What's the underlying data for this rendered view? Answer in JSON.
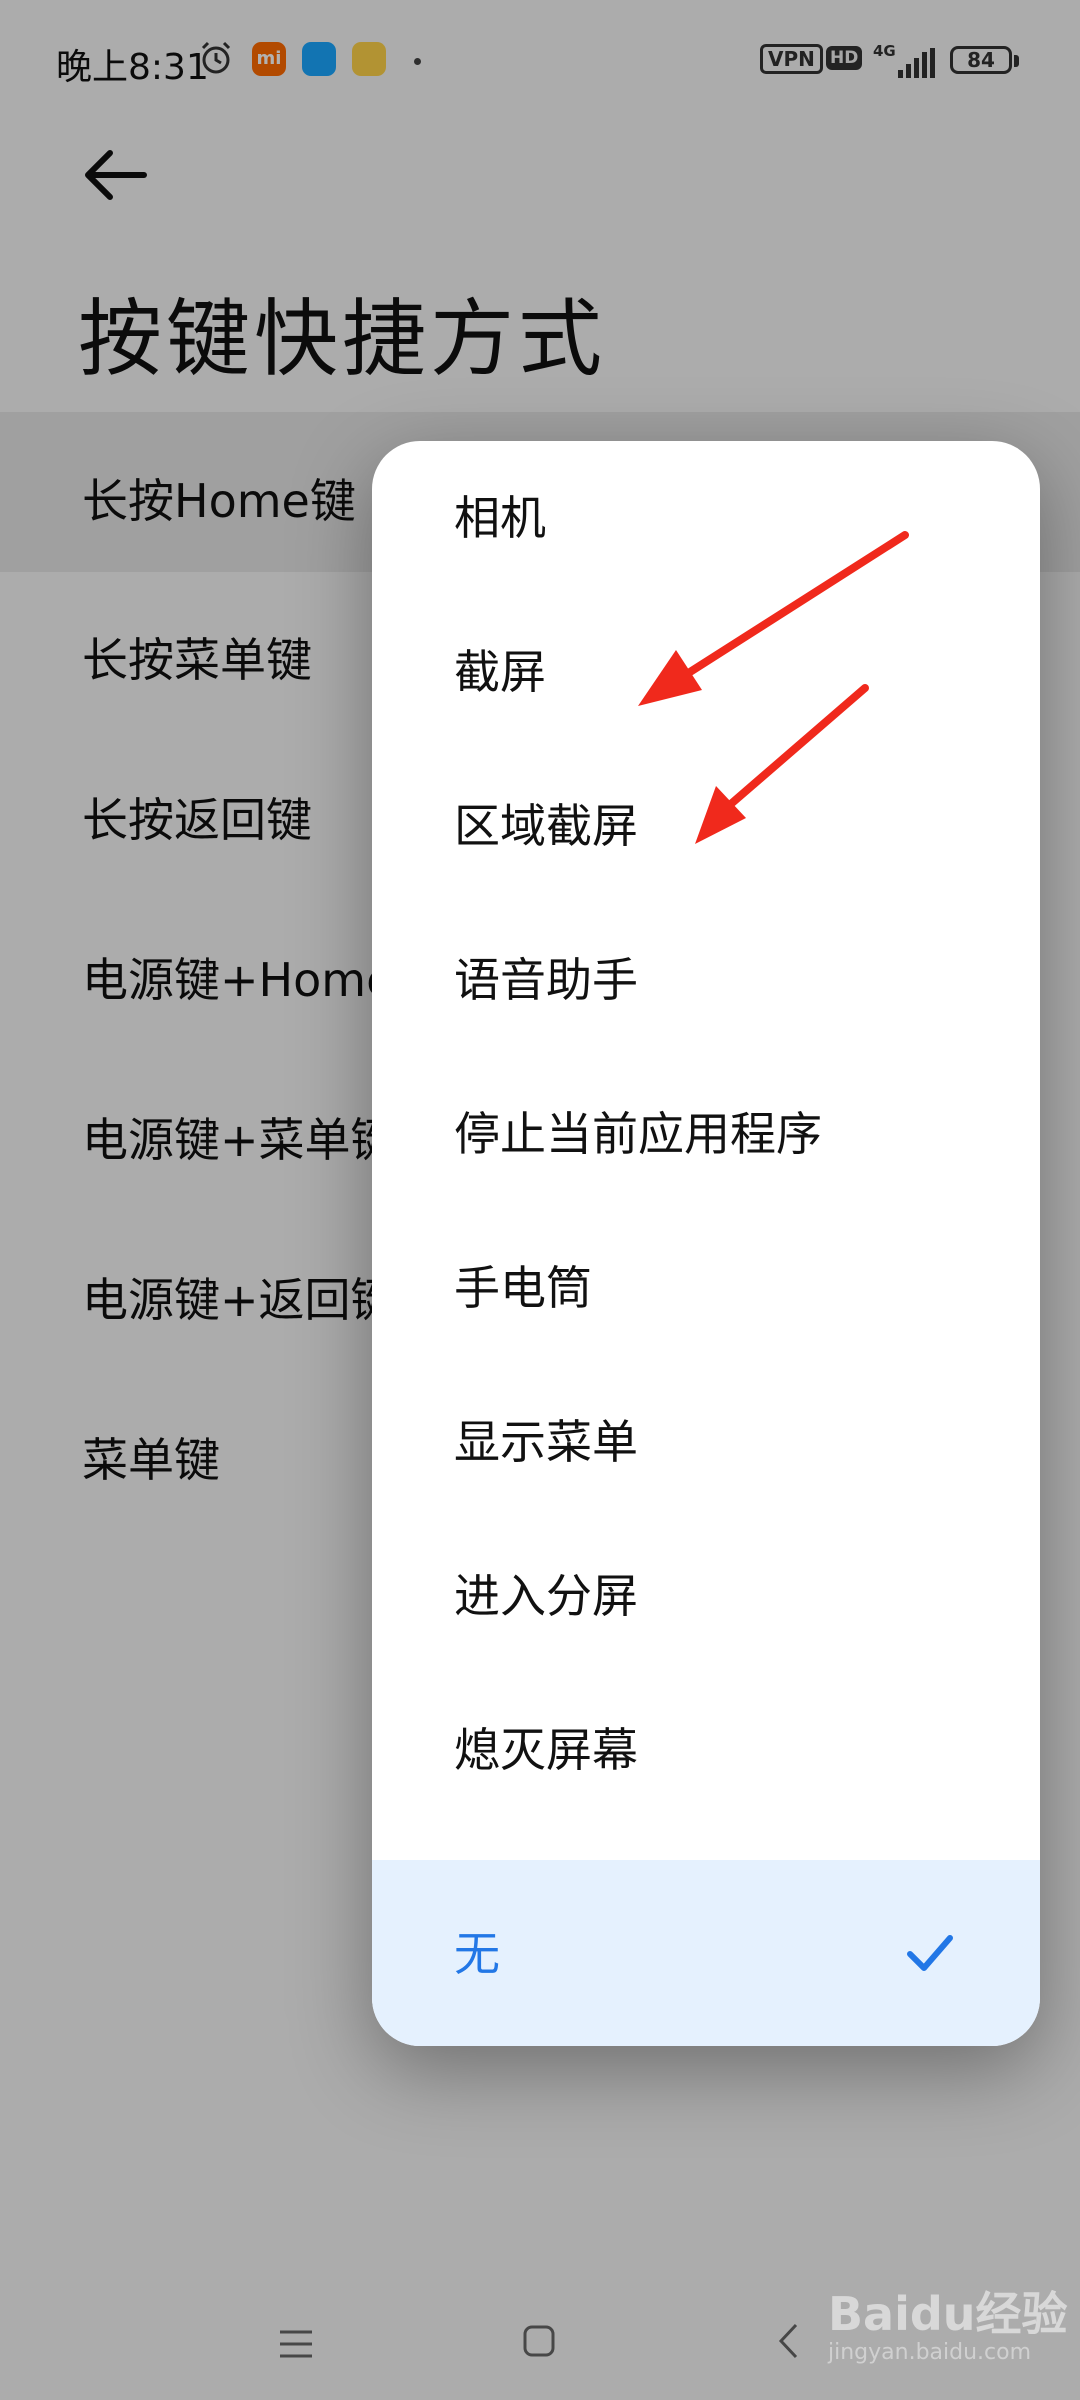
{
  "status_bar": {
    "time": "晚上8:31",
    "mi_badge": "mi",
    "vpn": "VPN",
    "hd": "HD",
    "network": "4G",
    "battery": "84",
    "icons": [
      "alarm-icon",
      "mi-app-icon",
      "message-app-icon",
      "weibo-app-icon",
      "signal-icon",
      "battery-icon"
    ]
  },
  "header": {
    "title": "按键快捷方式"
  },
  "settings_list": [
    {
      "label": "长按Home键"
    },
    {
      "label": "长按菜单键"
    },
    {
      "label": "长按返回键"
    },
    {
      "label": "电源键+Home键"
    },
    {
      "label": "电源键+菜单键"
    },
    {
      "label": "电源键+返回键"
    },
    {
      "label": "菜单键"
    }
  ],
  "menu": {
    "options": [
      {
        "label": "相机"
      },
      {
        "label": "截屏"
      },
      {
        "label": "区域截屏"
      },
      {
        "label": "语音助手"
      },
      {
        "label": "停止当前应用程序"
      },
      {
        "label": "手电筒"
      },
      {
        "label": "显示菜单"
      },
      {
        "label": "进入分屏"
      },
      {
        "label": "熄灭屏幕"
      }
    ],
    "selected": {
      "label": "无"
    },
    "accent_color": "#2277e6",
    "selected_bg": "#e5f1fe"
  },
  "watermark": {
    "brand": "Baidu经验",
    "url": "jingyan.baidu.com"
  }
}
